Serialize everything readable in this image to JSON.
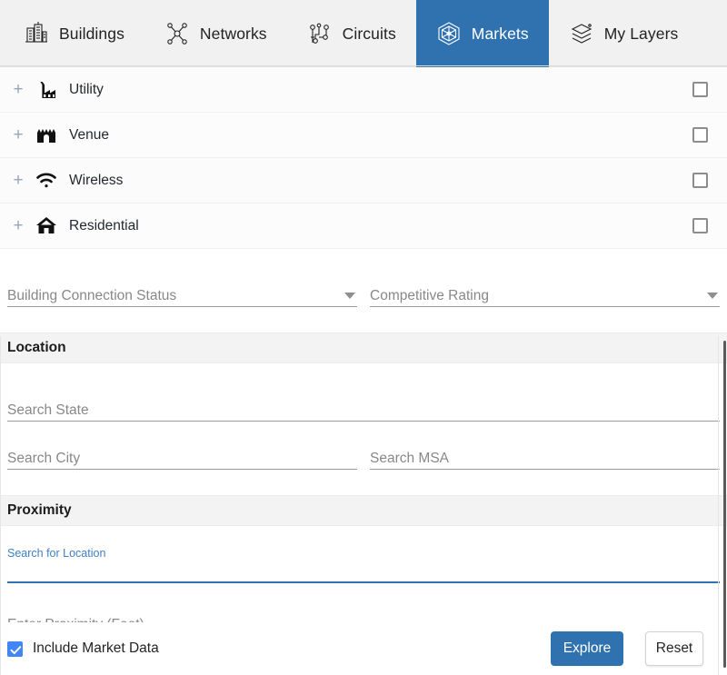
{
  "tabs": [
    {
      "label": "Buildings",
      "icon": "buildings-icon",
      "active": false
    },
    {
      "label": "Networks",
      "icon": "network-nodes-icon",
      "active": false
    },
    {
      "label": "Circuits",
      "icon": "circuit-icon",
      "active": false
    },
    {
      "label": "Markets",
      "icon": "markets-hexagon-icon",
      "active": true
    },
    {
      "label": "My Layers",
      "icon": "layers-icon",
      "active": false
    }
  ],
  "categories": [
    {
      "label": "Utility",
      "icon": "factory-icon",
      "expand": "+",
      "checked": false
    },
    {
      "label": "Venue",
      "icon": "stadium-icon",
      "expand": "+",
      "checked": false
    },
    {
      "label": "Wireless",
      "icon": "wifi-icon",
      "expand": "+",
      "checked": false
    },
    {
      "label": "Residential",
      "icon": "home-icon",
      "expand": "+",
      "checked": false
    }
  ],
  "filters": {
    "building_connection_status": {
      "placeholder": "Building Connection Status",
      "value": ""
    },
    "competitive_rating": {
      "placeholder": "Competitive Rating",
      "value": ""
    }
  },
  "location": {
    "heading": "Location",
    "search_state": {
      "placeholder": "Search State",
      "value": ""
    },
    "search_city": {
      "placeholder": "Search City",
      "value": ""
    },
    "search_msa": {
      "placeholder": "Search MSA",
      "value": ""
    }
  },
  "proximity": {
    "heading": "Proximity",
    "search_for_location": {
      "label": "Search for Location",
      "value": "",
      "focused": true
    },
    "enter_proximity": {
      "placeholder": "Enter Proximity (Feet)",
      "value": ""
    }
  },
  "footer": {
    "include_market_data": {
      "label": "Include Market Data",
      "checked": true
    },
    "explore_label": "Explore",
    "reset_label": "Reset"
  },
  "colors": {
    "accent_blue": "#3071b0",
    "checkbox_blue": "#4285f4",
    "link_blue": "#3f7fc6",
    "tabbar_bg": "#f1f1f1",
    "section_bg": "#f3f3f4"
  }
}
